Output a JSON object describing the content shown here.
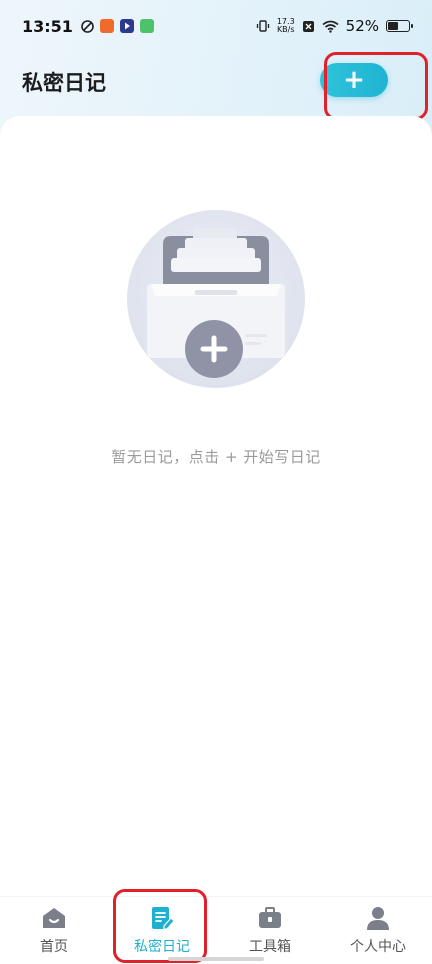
{
  "status_bar": {
    "time": "13:51",
    "net_speed_value": "17.3",
    "net_speed_unit": "KB/s",
    "battery_percent": "52%",
    "battery_level": 0.52
  },
  "header": {
    "title": "私密日记",
    "add_label": "+"
  },
  "empty_state": {
    "message": "暂无日记，点击 + 开始写日记",
    "illustration_icon": "empty-drawer-plus-icon"
  },
  "bottom_nav": {
    "items": [
      {
        "label": "首页",
        "icon": "home-icon"
      },
      {
        "label": "私密日记",
        "icon": "diary-edit-icon",
        "active": true
      },
      {
        "label": "工具箱",
        "icon": "toolbox-icon"
      },
      {
        "label": "个人中心",
        "icon": "person-icon"
      }
    ]
  },
  "colors": {
    "accent": "#1fb4d2",
    "highlight": "#e0202a",
    "inactive_text": "#555555",
    "empty_text": "#9a9a9a"
  }
}
